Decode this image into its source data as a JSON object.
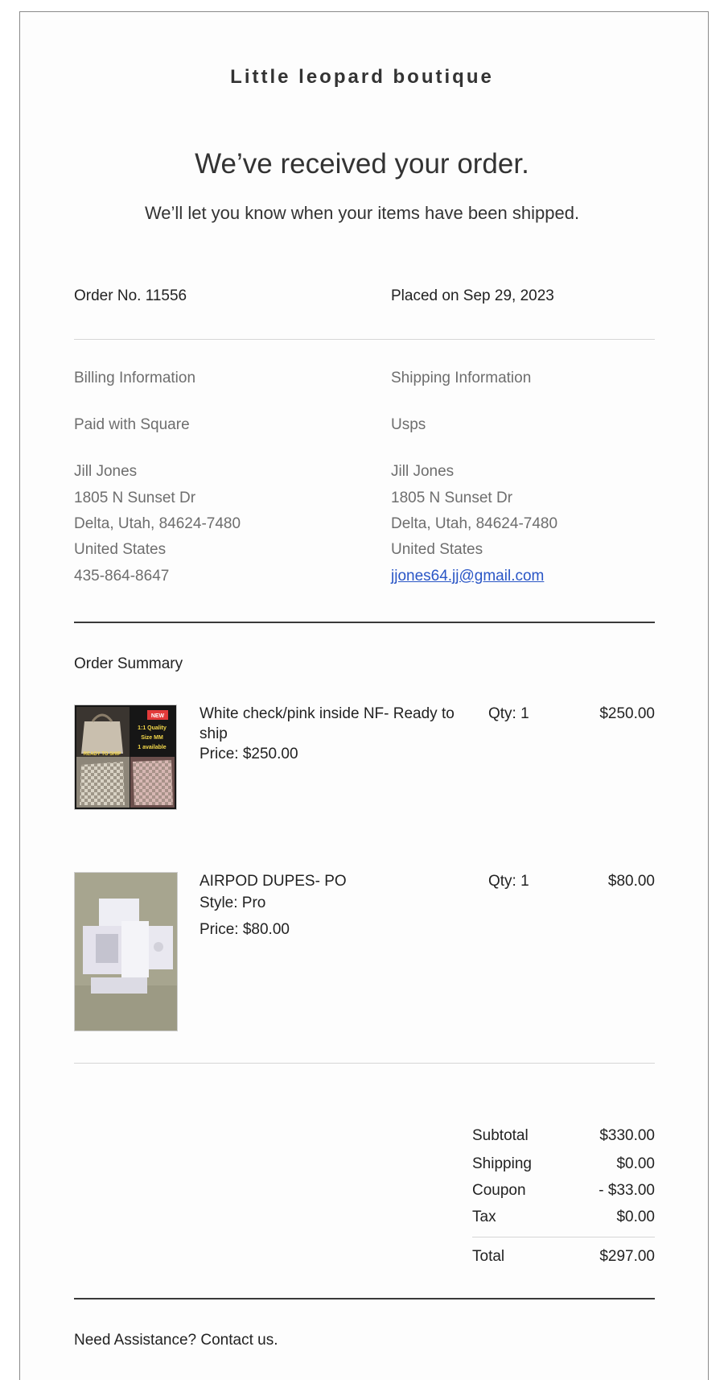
{
  "header": {
    "brand": "Little leopard boutique",
    "headline": "We’ve received your order.",
    "subline": "We’ll let you know when your items have been shipped."
  },
  "order": {
    "number_label": "Order No. 11556",
    "placed_label": "Placed on Sep 29, 2023"
  },
  "billing": {
    "title": "Billing Information",
    "payment": "Paid with Square",
    "name": "Jill Jones",
    "street": "1805 N Sunset Dr",
    "city_line": "Delta, Utah, 84624-7480",
    "country": "United States",
    "phone": "435-864-8647"
  },
  "shipping": {
    "title": "Shipping Information",
    "method": "Usps",
    "name": "Jill Jones",
    "street": "1805 N Sunset Dr",
    "city_line": "Delta, Utah, 84624-7480",
    "country": "United States",
    "email": "jjones64.jj@gmail.com"
  },
  "summary": {
    "title": "Order Summary",
    "items": [
      {
        "name": "White check/pink inside NF- Ready to ship",
        "price_label": "Price: $250.00",
        "qty_label": "Qty: 1",
        "total": "$250.00",
        "thumb_text": [
          "1:1 Quality",
          "Size MM",
          "1 available"
        ],
        "thumb_badge": "NEW",
        "thumb_banner": "READY TO SHIP"
      },
      {
        "name": "AIRPOD DUPES- PO",
        "style_label": "Style: Pro",
        "price_label": "Price: $80.00",
        "qty_label": "Qty: 1",
        "total": "$80.00"
      }
    ]
  },
  "totals": {
    "subtotal_label": "Subtotal",
    "subtotal": "$330.00",
    "shipping_label": "Shipping",
    "shipping": "$0.00",
    "coupon_label": "Coupon",
    "coupon": "- $33.00",
    "tax_label": "Tax",
    "tax": "$0.00",
    "total_label": "Total",
    "total": "$297.00"
  },
  "footer": {
    "assist": "Need Assistance? Contact us."
  },
  "colors": {
    "link": "#2a56c6",
    "muted_text": "#6e6e6e",
    "body_text": "#222222"
  }
}
